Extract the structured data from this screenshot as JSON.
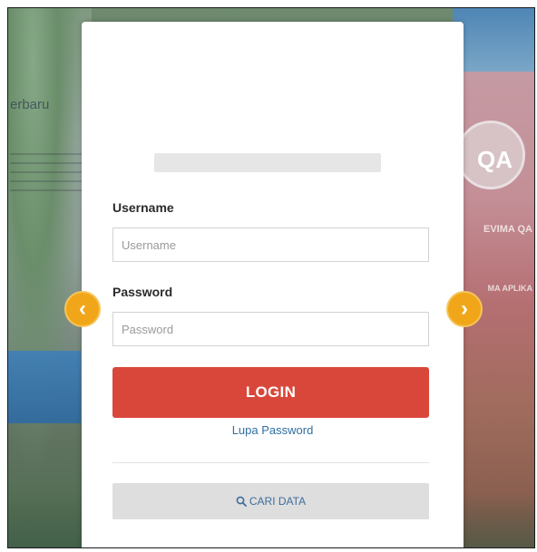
{
  "background": {
    "left_text": "erbaru",
    "right_badge": "QA",
    "right_label_1": "EVIMA QA",
    "right_label_2": "MA APLIKA"
  },
  "carousel": {
    "prev_icon": "chevron-left-icon",
    "next_icon": "chevron-right-icon",
    "prev_glyph": "‹",
    "next_glyph": "›",
    "accent_color": "#f1a619"
  },
  "login_form": {
    "username_label": "Username",
    "username_placeholder": "Username",
    "username_value": "",
    "password_label": "Password",
    "password_placeholder": "Password",
    "password_value": "",
    "login_button": "LOGIN",
    "login_color": "#d9473a",
    "forgot_link": "Lupa Password",
    "search_button": "CARI DATA",
    "search_icon": "search-icon"
  }
}
